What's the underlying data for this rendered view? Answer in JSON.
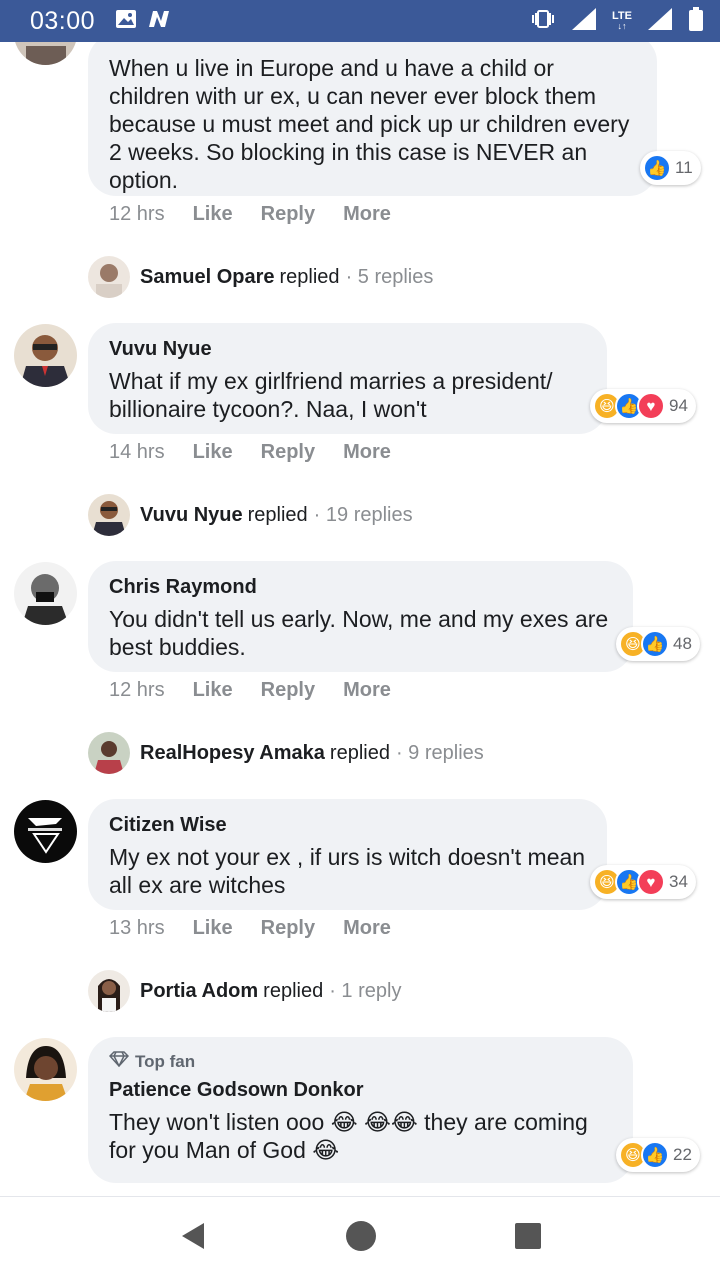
{
  "status_bar": {
    "time": "03:00",
    "network_label": "LTE",
    "bg_color": "#3b5998"
  },
  "comments": [
    {
      "author": "",
      "text": "When u live in Europe and u have a child or children with ur ex, u can never ever block them because u must meet and pick up ur children every 2 weeks. So blocking in this case is NEVER an option.",
      "reactions": [
        "like"
      ],
      "reaction_count": "11",
      "time": "12 hrs",
      "like_label": "Like",
      "reply_label": "Reply",
      "more_label": "More",
      "replied": {
        "name": "Samuel Opare",
        "word": "replied",
        "count": "· 5 replies"
      }
    },
    {
      "author": "Vuvu Nyue",
      "text": "What if my ex girlfriend marries a president/ billionaire tycoon?. Naa, I won't",
      "reactions": [
        "haha",
        "like",
        "love"
      ],
      "reaction_count": "94",
      "time": "14 hrs",
      "like_label": "Like",
      "reply_label": "Reply",
      "more_label": "More",
      "replied": {
        "name": "Vuvu Nyue",
        "word": "replied",
        "count": "· 19 replies"
      }
    },
    {
      "author": "Chris Raymond",
      "text": "You didn't tell us early. Now, me and my exes are best buddies.",
      "reactions": [
        "haha",
        "like"
      ],
      "reaction_count": "48",
      "time": "12 hrs",
      "like_label": "Like",
      "reply_label": "Reply",
      "more_label": "More",
      "replied": {
        "name": "RealHopesy Amaka",
        "word": "replied",
        "count": "· 9 replies"
      }
    },
    {
      "author": "Citizen Wise",
      "text": "My ex not your ex , if urs is witch doesn't mean all ex are witches",
      "reactions": [
        "haha",
        "like",
        "love"
      ],
      "reaction_count": "34",
      "time": "13 hrs",
      "like_label": "Like",
      "reply_label": "Reply",
      "more_label": "More",
      "replied": {
        "name": "Portia Adom",
        "word": "replied",
        "count": "· 1 reply"
      }
    },
    {
      "badge": "Top fan",
      "author": "Patience Godsown Donkor",
      "text": "They won't listen ooo 😂 😂😂 they are coming for you Man of God 😂",
      "reactions": [
        "haha",
        "like"
      ],
      "reaction_count": "22"
    }
  ],
  "colors": {
    "bubble": "#f0f2f5",
    "like": "#1877f2",
    "haha": "#f7b125",
    "love": "#f33e58",
    "muted": "#8a8d91"
  }
}
